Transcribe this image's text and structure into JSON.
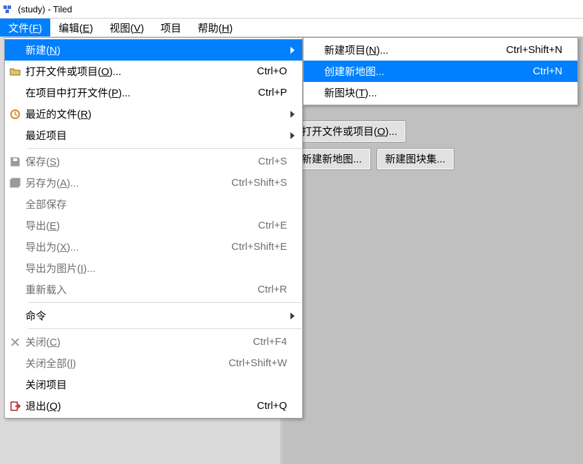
{
  "window": {
    "title": "(study) - Tiled"
  },
  "menubar": {
    "items": [
      {
        "pre": "文件(",
        "ul": "F",
        "post": ")"
      },
      {
        "pre": "编辑(",
        "ul": "E",
        "post": ")"
      },
      {
        "pre": "视图(",
        "ul": "V",
        "post": ")"
      },
      {
        "pre": "项目",
        "ul": "",
        "post": ""
      },
      {
        "pre": "帮助(",
        "ul": "H",
        "post": ")"
      }
    ]
  },
  "file_menu": {
    "items": [
      {
        "kind": "item",
        "icon": "",
        "pre": "新建(",
        "ul": "N",
        "post": ")",
        "shortcut": "",
        "arrow": true,
        "hl": true,
        "disabled": false
      },
      {
        "kind": "item",
        "icon": "open",
        "pre": "打开文件或项目(",
        "ul": "O",
        "post": ")...",
        "shortcut": "Ctrl+O",
        "arrow": false,
        "hl": false,
        "disabled": false
      },
      {
        "kind": "item",
        "icon": "",
        "pre": "在项目中打开文件(",
        "ul": "P",
        "post": ")...",
        "shortcut": "Ctrl+P",
        "arrow": false,
        "hl": false,
        "disabled": false
      },
      {
        "kind": "item",
        "icon": "recent",
        "pre": "最近的文件(",
        "ul": "R",
        "post": ")",
        "shortcut": "",
        "arrow": true,
        "hl": false,
        "disabled": false
      },
      {
        "kind": "item",
        "icon": "",
        "pre": "最近项目",
        "ul": "",
        "post": "",
        "shortcut": "",
        "arrow": true,
        "hl": false,
        "disabled": false
      },
      {
        "kind": "sep"
      },
      {
        "kind": "item",
        "icon": "save",
        "pre": "保存(",
        "ul": "S",
        "post": ")",
        "shortcut": "Ctrl+S",
        "arrow": false,
        "hl": false,
        "disabled": true
      },
      {
        "kind": "item",
        "icon": "saveas",
        "pre": "另存为(",
        "ul": "A",
        "post": ")...",
        "shortcut": "Ctrl+Shift+S",
        "arrow": false,
        "hl": false,
        "disabled": true
      },
      {
        "kind": "item",
        "icon": "",
        "pre": "全部保存",
        "ul": "",
        "post": "",
        "shortcut": "",
        "arrow": false,
        "hl": false,
        "disabled": true
      },
      {
        "kind": "item",
        "icon": "",
        "pre": "导出(",
        "ul": "E",
        "post": ")",
        "shortcut": "Ctrl+E",
        "arrow": false,
        "hl": false,
        "disabled": true
      },
      {
        "kind": "item",
        "icon": "",
        "pre": "导出为(",
        "ul": "X",
        "post": ")...",
        "shortcut": "Ctrl+Shift+E",
        "arrow": false,
        "hl": false,
        "disabled": true
      },
      {
        "kind": "item",
        "icon": "",
        "pre": "导出为图片(",
        "ul": "I",
        "post": ")...",
        "shortcut": "",
        "arrow": false,
        "hl": false,
        "disabled": true
      },
      {
        "kind": "item",
        "icon": "",
        "pre": "重新载入",
        "ul": "",
        "post": "",
        "shortcut": "Ctrl+R",
        "arrow": false,
        "hl": false,
        "disabled": true
      },
      {
        "kind": "sep"
      },
      {
        "kind": "item",
        "icon": "",
        "pre": "命令",
        "ul": "",
        "post": "",
        "shortcut": "",
        "arrow": true,
        "hl": false,
        "disabled": false
      },
      {
        "kind": "sep"
      },
      {
        "kind": "item",
        "icon": "close",
        "pre": "关闭(",
        "ul": "C",
        "post": ")",
        "shortcut": "Ctrl+F4",
        "arrow": false,
        "hl": false,
        "disabled": true
      },
      {
        "kind": "item",
        "icon": "",
        "pre": "关闭全部(",
        "ul": "l",
        "post": ")",
        "shortcut": "Ctrl+Shift+W",
        "arrow": false,
        "hl": false,
        "disabled": true
      },
      {
        "kind": "item",
        "icon": "",
        "pre": "关闭项目",
        "ul": "",
        "post": "",
        "shortcut": "",
        "arrow": false,
        "hl": false,
        "disabled": false
      },
      {
        "kind": "item",
        "icon": "quit",
        "pre": "退出(",
        "ul": "Q",
        "post": ")",
        "shortcut": "Ctrl+Q",
        "arrow": false,
        "hl": false,
        "disabled": false
      }
    ]
  },
  "sub_menu": {
    "items": [
      {
        "pre": "新建项目(",
        "ul": "N",
        "post": ")...",
        "shortcut": "Ctrl+Shift+N",
        "hl": false
      },
      {
        "pre": "创建新地图...",
        "ul": "",
        "post": "",
        "shortcut": "Ctrl+N",
        "hl": true
      },
      {
        "pre": "新图块(",
        "ul": "T",
        "post": ")...",
        "shortcut": "",
        "hl": false
      }
    ]
  },
  "main_buttons": {
    "row1_pre": "打开文件或项目(",
    "row1_ul": "O",
    "row1_post": ")...",
    "row2a": "新建新地图...",
    "row2b": "新建图块集..."
  }
}
